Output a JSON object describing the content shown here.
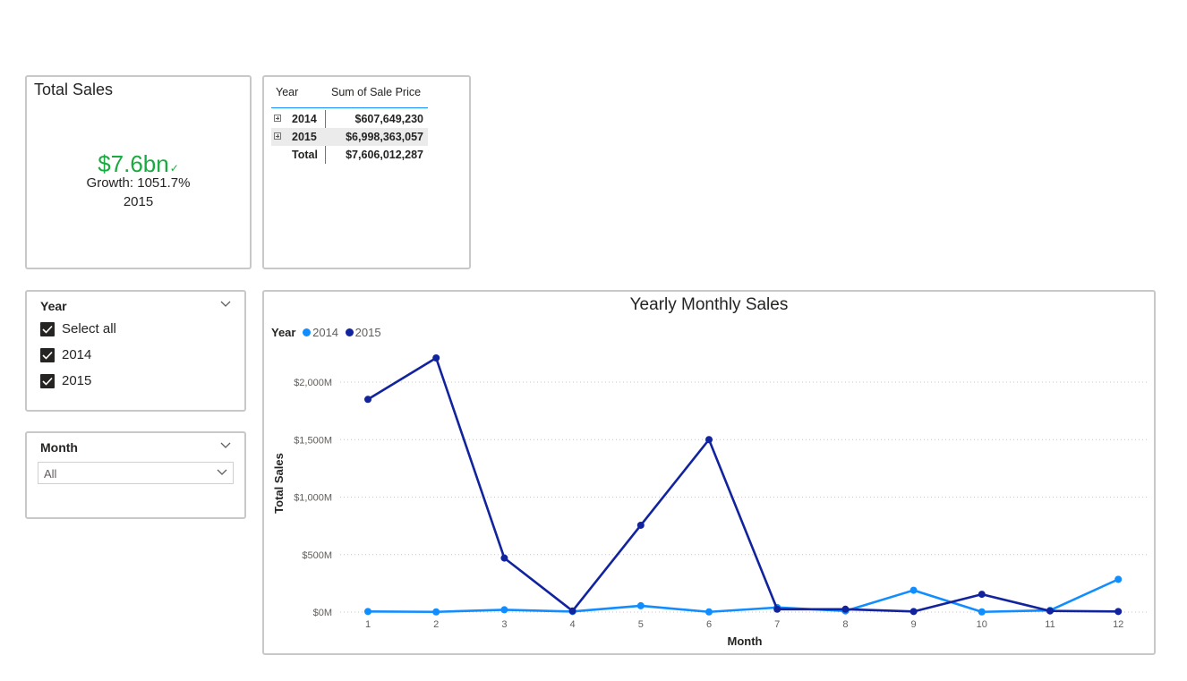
{
  "kpi": {
    "title": "Total Sales",
    "value": "$7.6bn",
    "trend_icon": "check-icon",
    "growth": "Growth: 1051.7%",
    "year": "2015",
    "accent_color": "#1aab40"
  },
  "matrix": {
    "headers": {
      "year": "Year",
      "measure": "Sum of Sale Price"
    },
    "rows": [
      {
        "year": "2014",
        "value": "$607,649,230"
      },
      {
        "year": "2015",
        "value": "$6,998,363,057"
      }
    ],
    "total": {
      "label": "Total",
      "value": "$7,606,012,287"
    }
  },
  "year_slicer": {
    "title": "Year",
    "items": [
      {
        "label": "Select all",
        "checked": true
      },
      {
        "label": "2014",
        "checked": true
      },
      {
        "label": "2015",
        "checked": true
      }
    ]
  },
  "month_slicer": {
    "title": "Month",
    "selected": "All"
  },
  "chart_data": {
    "type": "line",
    "title": "Yearly Monthly Sales",
    "legend_title": "Year",
    "legend_position": "top-left",
    "xlabel": "Month",
    "ylabel": "Total Sales",
    "x": [
      1,
      2,
      3,
      4,
      5,
      6,
      7,
      8,
      9,
      10,
      11,
      12
    ],
    "ylim": [
      0,
      2000
    ],
    "yticks": [
      {
        "value": 0,
        "label": "$0M"
      },
      {
        "value": 500,
        "label": "$500M"
      },
      {
        "value": 1000,
        "label": "$1,000M"
      },
      {
        "value": 1500,
        "label": "$1,500M"
      },
      {
        "value": 2000,
        "label": "$2,000M"
      }
    ],
    "grid": true,
    "series": [
      {
        "name": "2014",
        "color": "#118dff",
        "values": [
          5,
          2,
          20,
          5,
          55,
          2,
          40,
          10,
          190,
          2,
          15,
          285
        ]
      },
      {
        "name": "2015",
        "color": "#12239e",
        "values": [
          1850,
          2210,
          470,
          10,
          755,
          1500,
          25,
          25,
          5,
          155,
          10,
          5
        ]
      }
    ]
  }
}
